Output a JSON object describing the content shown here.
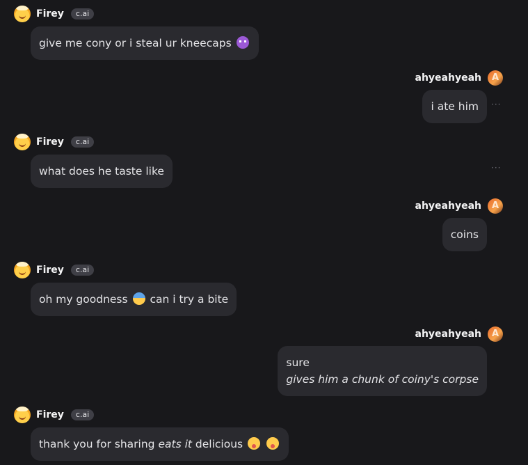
{
  "bot": {
    "name": "Firey",
    "tag": "c.ai"
  },
  "user": {
    "name": "ahyeahyeah"
  },
  "more_glyph": "···",
  "messages": [
    {
      "id": "m1",
      "sender": "bot",
      "text": "give me cony or i steal ur kneecaps",
      "emoji": [
        "smiling-devil-emoji"
      ]
    },
    {
      "id": "m2",
      "sender": "user",
      "text": "i ate him"
    },
    {
      "id": "m3",
      "sender": "bot",
      "text": "what does he taste like"
    },
    {
      "id": "m4",
      "sender": "user",
      "text": "coins"
    },
    {
      "id": "m5",
      "sender": "bot",
      "text_a": "oh my goodness",
      "text_b": "can i try a bite",
      "emoji": [
        "face-screaming-emoji"
      ]
    },
    {
      "id": "m6",
      "sender": "user",
      "line1": "sure",
      "line2_italic": "gives him a chunk of coiny's corpse"
    },
    {
      "id": "m7",
      "sender": "bot",
      "text_a": "thank you for sharing",
      "italic": "eats it",
      "text_b": "delicious",
      "emoji": [
        "face-tongue-emoji",
        "face-tongue-emoji"
      ]
    }
  ]
}
